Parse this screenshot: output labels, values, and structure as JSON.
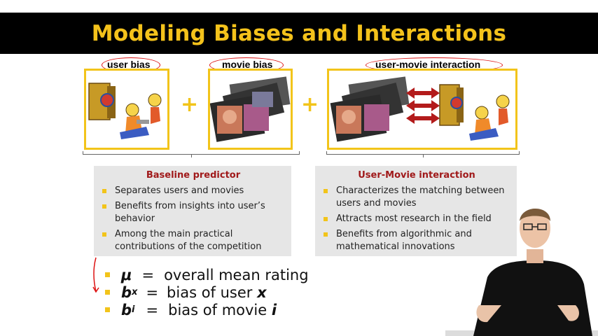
{
  "slide": {
    "title": "Modeling Biases and Interactions",
    "labels": {
      "user_bias": "user bias",
      "movie_bias": "movie bias",
      "interaction": "user-movie interaction"
    },
    "operators": {
      "plus1": "+",
      "plus2": "+"
    },
    "baseline": {
      "heading": "Baseline predictor",
      "bullets": [
        "Separates users and movies",
        "Benefits from insights into user’s behavior",
        "Among the main practical contributions of the competition"
      ]
    },
    "interaction_panel": {
      "heading": "User-Movie interaction",
      "bullets": [
        "Characterizes the matching between users and movies",
        "Attracts most research in the field",
        "Benefits from algorithmic and mathematical innovations"
      ]
    },
    "formulas": {
      "mu": {
        "symbol": "μ",
        "eq": "=",
        "text": "overall mean rating"
      },
      "bx": {
        "symbol": "b",
        "sub": "x",
        "eq": "=",
        "text": "bias of user ",
        "var": "x"
      },
      "bi": {
        "symbol": "b",
        "sub": "i",
        "eq": "=",
        "text": "bias of movie ",
        "var": "i"
      }
    },
    "colors": {
      "title_bg": "#000000",
      "title_fg": "#f4c21b",
      "accent": "#f2c41a",
      "heading_red": "#a0191a",
      "annotation_red": "#dd1111"
    }
  }
}
